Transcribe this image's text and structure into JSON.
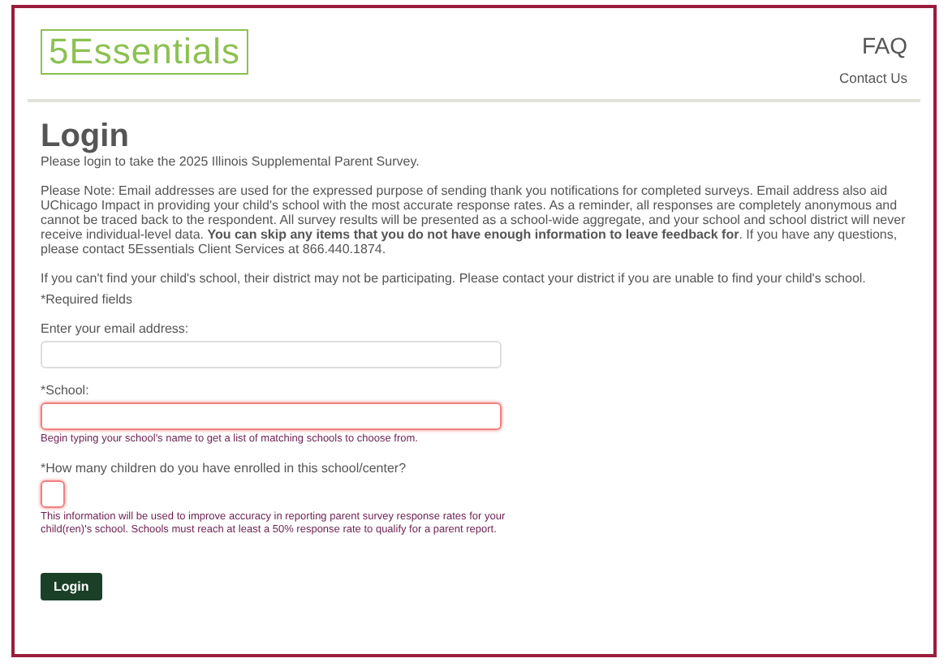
{
  "header": {
    "logo": "5Essentials",
    "links": [
      {
        "label": "FAQ",
        "kind": "large"
      },
      {
        "label": "Contact Us",
        "kind": "small"
      }
    ]
  },
  "title": "Login",
  "subtitle": "Please login to take the 2025 Illinois Supplemental Parent Survey.",
  "paragraphs": [
    "Please Note: Email addresses are used for the expressed purpose of sending thank you notifications for completed surveys. Email address also aid UChicago Impact in providing your child's school with the most accurate response rates. As a reminder, all responses are completely anonymous and cannot be traced back to the respondent. All survey results will be presented as a school-wide aggregate, and your school and school district will never receive individual-level data. **You can skip any items that you do not have enough information to leave feedback for**. If you have any questions, please contact 5Essentials Client Services at 866.440.1874.",
    "If you can't find your child's school, their district may not be participating. Please contact your district if you are unable to find your child's school."
  ],
  "required_note": "*Required fields",
  "fields": [
    {
      "label": "Enter your email address:",
      "kind": "wide",
      "invalid": false
    },
    {
      "label": "*School:",
      "kind": "wide",
      "invalid": true,
      "hint": "Begin typing your school's name to get a list of matching schools to choose from."
    },
    {
      "label": "*How many children do you have enrolled in this school/center?",
      "kind": "small",
      "invalid": true,
      "hint": "This information will be used to improve accuracy in reporting parent survey response rates for your child(ren)'s school. Schools must reach at least a 50% response rate to qualify for a parent report."
    }
  ],
  "button": "Login"
}
